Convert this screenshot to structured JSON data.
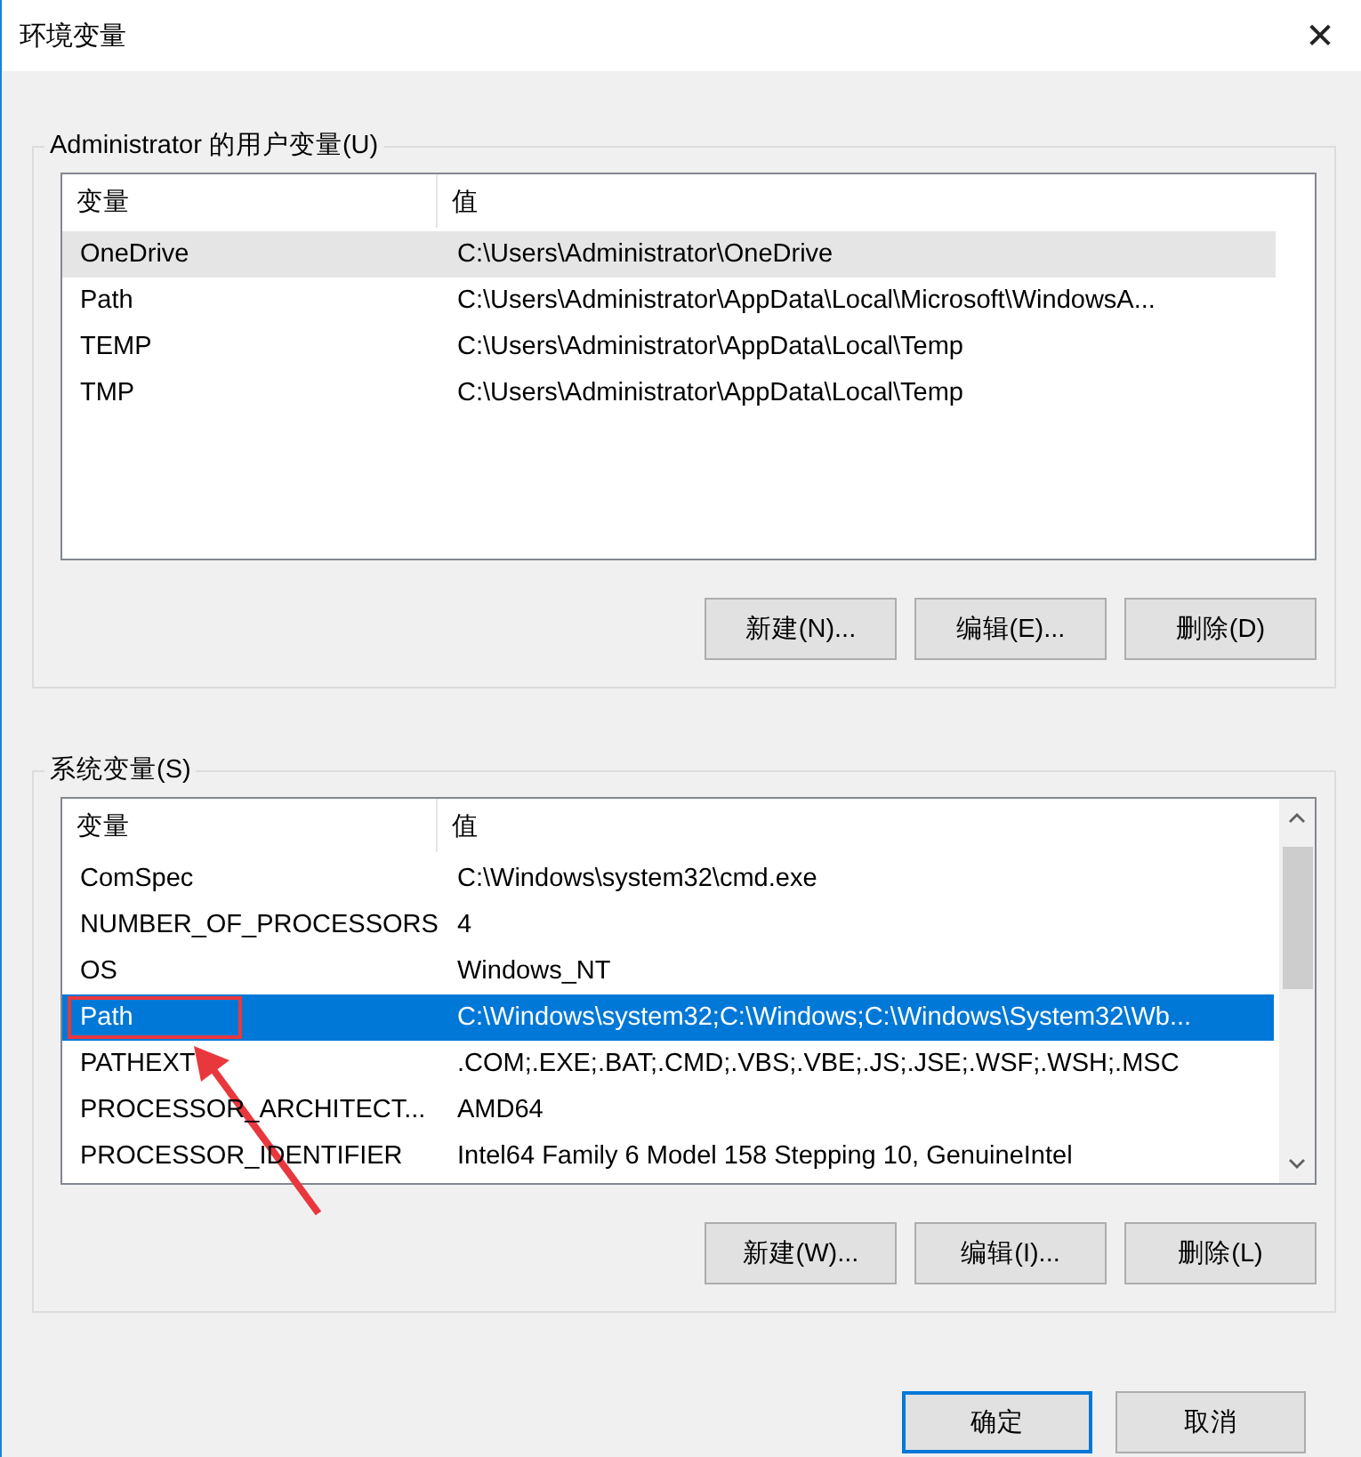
{
  "window": {
    "title": "环境变量",
    "close": "✕"
  },
  "user_vars": {
    "label": "Administrator 的用户变量(U)",
    "columns": [
      "变量",
      "值"
    ],
    "scrollbar": false,
    "focused": false,
    "rows": [
      {
        "name": "OneDrive",
        "value": "C:\\Users\\Administrator\\OneDrive",
        "selected": true,
        "highlighted": false
      },
      {
        "name": "Path",
        "value": "C:\\Users\\Administrator\\AppData\\Local\\Microsoft\\WindowsA...",
        "selected": false,
        "highlighted": false
      },
      {
        "name": "TEMP",
        "value": "C:\\Users\\Administrator\\AppData\\Local\\Temp",
        "selected": false,
        "highlighted": false
      },
      {
        "name": "TMP",
        "value": "C:\\Users\\Administrator\\AppData\\Local\\Temp",
        "selected": false,
        "highlighted": false
      }
    ],
    "buttons": [
      "新建(N)...",
      "编辑(E)...",
      "删除(D)"
    ]
  },
  "system_vars": {
    "label": "系统变量(S)",
    "columns": [
      "变量",
      "值"
    ],
    "scrollbar": true,
    "focused": true,
    "rows": [
      {
        "name": "ComSpec",
        "value": "C:\\Windows\\system32\\cmd.exe",
        "selected": false,
        "highlighted": false
      },
      {
        "name": "NUMBER_OF_PROCESSORS",
        "value": "4",
        "selected": false,
        "highlighted": false
      },
      {
        "name": "OS",
        "value": "Windows_NT",
        "selected": false,
        "highlighted": false
      },
      {
        "name": "Path",
        "value": "C:\\Windows\\system32;C:\\Windows;C:\\Windows\\System32\\Wb...",
        "selected": true,
        "highlighted": true
      },
      {
        "name": "PATHEXT",
        "value": ".COM;.EXE;.BAT;.CMD;.VBS;.VBE;.JS;.JSE;.WSF;.WSH;.MSC",
        "selected": false,
        "highlighted": false
      },
      {
        "name": "PROCESSOR_ARCHITECT...",
        "value": "AMD64",
        "selected": false,
        "highlighted": false
      },
      {
        "name": "PROCESSOR_IDENTIFIER",
        "value": "Intel64 Family 6 Model 158 Stepping 10, GenuineIntel",
        "selected": false,
        "highlighted": false
      }
    ],
    "buttons": [
      "新建(W)...",
      "编辑(I)...",
      "删除(L)"
    ]
  },
  "footer_buttons": [
    {
      "label": "确定",
      "default": true
    },
    {
      "label": "取消",
      "default": false
    }
  ]
}
